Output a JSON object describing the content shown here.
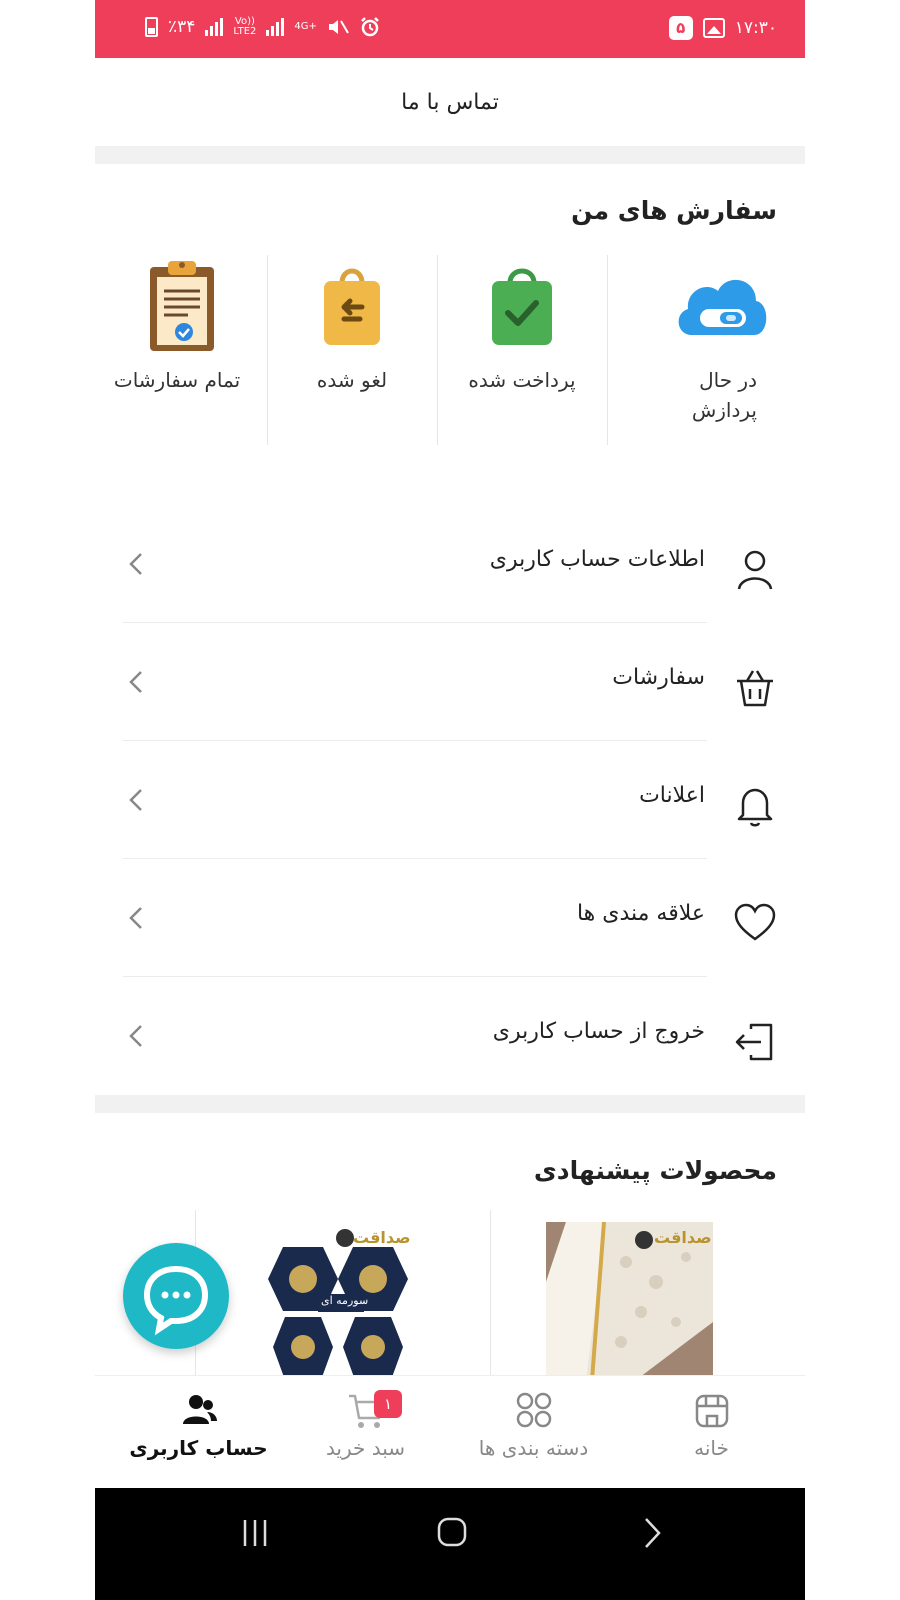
{
  "status_bar": {
    "battery": "٪۳۴",
    "network_label_top": "Vo))",
    "network_label_bottom": "LTE2",
    "data_label": "4G+",
    "notification_count": "۵",
    "time": "۱۷:۳۰"
  },
  "contact": {
    "label": "تماس با ما"
  },
  "orders": {
    "title": "سفارش های من",
    "items": [
      {
        "label": "در حال\nپردازش",
        "icon": "cloud-toggle-icon"
      },
      {
        "label": "پرداخت شده",
        "icon": "paid-bag-icon"
      },
      {
        "label": "لغو شده",
        "icon": "cancelled-bag-icon"
      },
      {
        "label": "تمام سفارشات",
        "icon": "clipboard-icon"
      }
    ]
  },
  "menu": {
    "items": [
      {
        "label": "اطلاعات حساب کاربری",
        "icon": "user-icon"
      },
      {
        "label": "سفارشات",
        "icon": "basket-icon"
      },
      {
        "label": "اعلانات",
        "icon": "bell-icon"
      },
      {
        "label": "علاقه مندی ها",
        "icon": "heart-icon"
      },
      {
        "label": "خروج از حساب کاربری",
        "icon": "logout-icon"
      }
    ]
  },
  "suggested": {
    "title": "محصولات پیشنهادی",
    "products": [
      {
        "brand": "صداقت",
        "image": "fabric-product-image"
      },
      {
        "brand": "صداقت",
        "caption": "سورمه ای",
        "image": "navy-pattern-product-image"
      }
    ]
  },
  "bottom_nav": {
    "items": [
      {
        "label": "خانه",
        "icon": "home-icon"
      },
      {
        "label": "دسته بندی ها",
        "icon": "categories-icon"
      },
      {
        "label": "سبد خرید",
        "icon": "cart-icon",
        "badge": "۱"
      },
      {
        "label": "حساب کاربری",
        "icon": "users-icon",
        "active": true
      }
    ]
  },
  "colors": {
    "accent": "#ee3e5a",
    "chat_fab": "#1fb8c7"
  }
}
